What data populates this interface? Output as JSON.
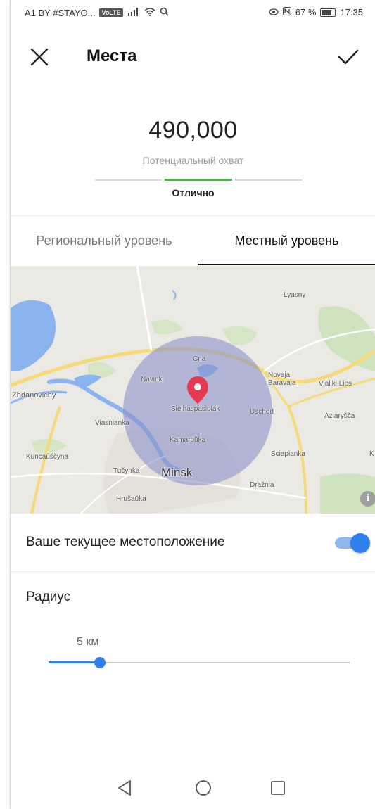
{
  "status_bar": {
    "carrier": "A1 BY #STAYO...",
    "badge": "VoLTE",
    "battery": "67 %",
    "time": "17:35",
    "icons": [
      "signal-icon",
      "wifi-icon",
      "search-icon",
      "eye-icon",
      "nfc-icon",
      "battery-icon"
    ]
  },
  "header": {
    "title": "Места",
    "close_icon": "close-icon",
    "done_icon": "checkmark-icon"
  },
  "reach": {
    "value": "490,000",
    "label": "Потенциальный охват",
    "rating": "Отлично",
    "meter_active_segment": 2,
    "meter_segments": 3,
    "meter_color": "#4caf50"
  },
  "tabs": [
    {
      "label": "Региональный уровень",
      "selected": false
    },
    {
      "label": "Местный уровень",
      "selected": true
    }
  ],
  "map": {
    "labels": {
      "lyasny": "Lyasny",
      "cna": "Cna",
      "navinki": "Navinki",
      "novaja_baravaja": "Novaja\nBaravaja",
      "vialiki_lies": "Vialiki Lies",
      "zhdanovichy": "Zhdanovichy",
      "sielhaspasiolak": "Sielhaspasiolak",
      "uschod": "Uschod",
      "aziaryshcha": "Aziaryšča",
      "viasnianka": "Viasnianka",
      "kamarouka": "Kamaroŭka",
      "sciapianka": "Sciapianka",
      "k": "K",
      "kuncaushchyna": "Kuncaŭščyna",
      "tucynka": "Tučynka",
      "minsk": "Minsk",
      "drazhnia": "Dražnia",
      "hrusauka": "Hrušaŭka"
    },
    "pin_icon": "map-pin-icon",
    "info_icon": "info-icon",
    "info_glyph": "i",
    "radius_circle_color": "#8c93c9",
    "pin_color": "#e53950"
  },
  "location": {
    "label": "Ваше текущее местоположение",
    "toggle_on": true,
    "accent": "#2f80ed"
  },
  "radius": {
    "title": "Радиус",
    "value_label": "5 км",
    "slider_fraction": 0.17
  },
  "nav": {
    "icons": [
      "back-icon",
      "home-icon",
      "recents-icon"
    ]
  }
}
